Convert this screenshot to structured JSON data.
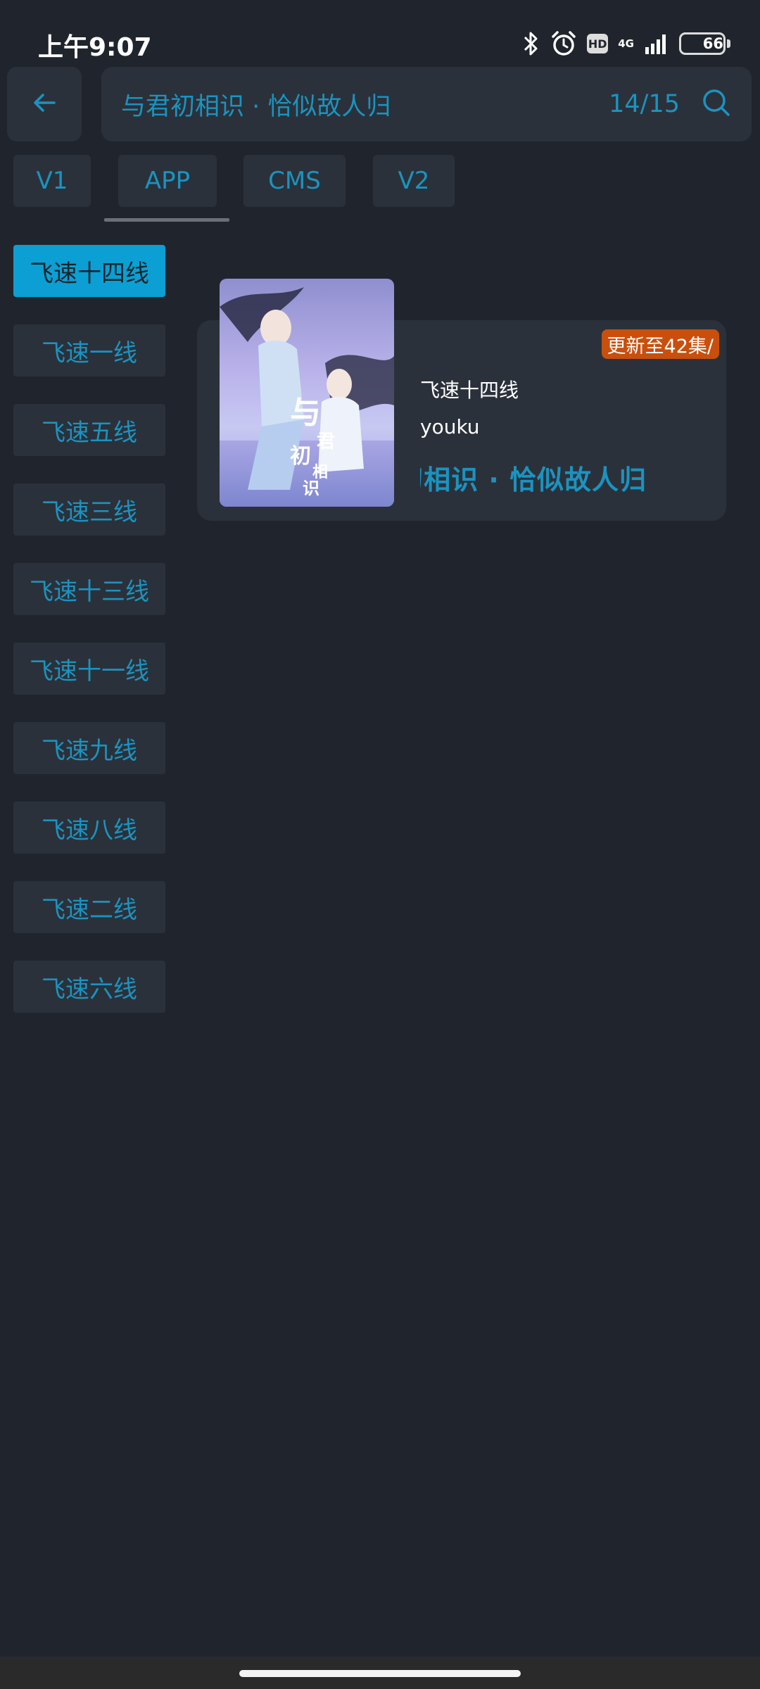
{
  "status_bar": {
    "time": "上午9:07",
    "hd_label": "HD",
    "network_label": "4G",
    "battery_level": "66"
  },
  "header": {
    "search_title": "与君初相识 · 恰似故人归",
    "result_count": "14/15"
  },
  "source_tabs": [
    {
      "label": "V1"
    },
    {
      "label": "APP"
    },
    {
      "label": "CMS"
    },
    {
      "label": "V2"
    }
  ],
  "selected_source_tab": "APP",
  "lines": [
    {
      "label": "飞速十四线",
      "active": true
    },
    {
      "label": "飞速一线"
    },
    {
      "label": "飞速五线"
    },
    {
      "label": "飞速三线"
    },
    {
      "label": "飞速十三线"
    },
    {
      "label": "飞速十一线"
    },
    {
      "label": "飞速九线"
    },
    {
      "label": "飞速八线"
    },
    {
      "label": "飞速二线"
    },
    {
      "label": "飞速六线"
    }
  ],
  "result_card": {
    "badge": "更新至42集/",
    "line": "飞速十四线",
    "source": "youku",
    "title": "与君初相识 · 恰似故人归    与君初相识 · 恰似故人归",
    "poster_calligraphy": "与君初相识"
  },
  "colors": {
    "background": "#20252d",
    "surface": "#2b313a",
    "accent": "#1b93c0",
    "active_item": "#0b9fd4",
    "badge": "#c94f0c"
  }
}
